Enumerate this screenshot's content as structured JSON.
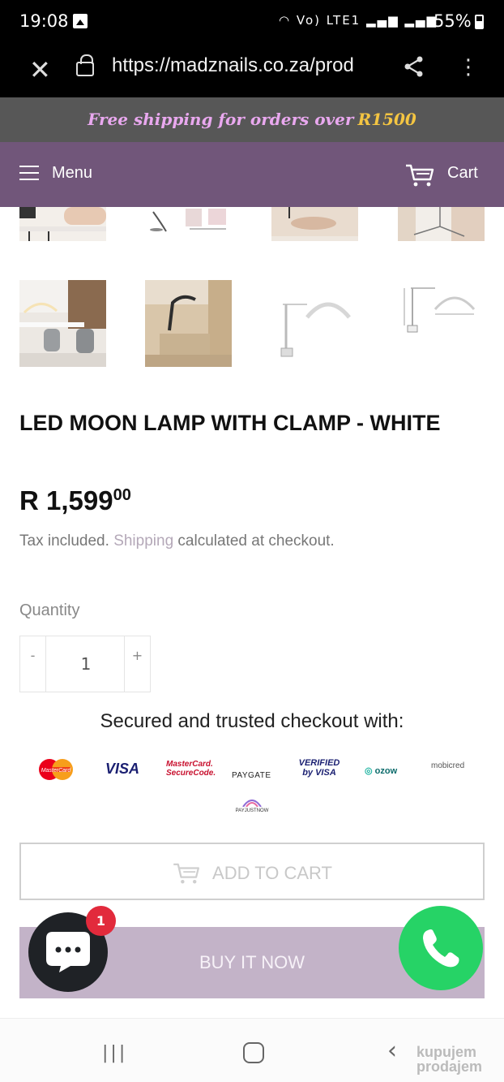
{
  "status_bar": {
    "time": "19:08",
    "network": "Vo) LTE1",
    "battery": "55%"
  },
  "browser": {
    "url": "https://madznails.co.za/prod"
  },
  "announcement": {
    "text": "Free shipping for orders over",
    "amount": "R1500",
    "text_color": "#e9a8ef",
    "amount_color": "#f4c542"
  },
  "header": {
    "menu_label": "Menu",
    "cart_label": "Cart",
    "bg_color": "#71567a"
  },
  "gallery": {
    "thumbnails": [
      "lamp-at-desk",
      "lamp-with-tools",
      "lamp-over-client",
      "lamp-base",
      "lamp-salon-room",
      "lamp-spa-bed",
      "lamp-white-clamp",
      "lamp-dimensions"
    ]
  },
  "product": {
    "title": "LED MOON LAMP WITH CLAMP - WHITE",
    "price_main": "R 1,599",
    "price_cents": "00",
    "tax_text_1": "Tax included.",
    "tax_link": "Shipping",
    "tax_text_2": "calculated at checkout."
  },
  "quantity": {
    "label": "Quantity",
    "minus": "-",
    "value": "1",
    "plus": "+"
  },
  "checkout": {
    "secure_text": "Secured and trusted checkout with:",
    "payment_methods": [
      "MasterCard",
      "VISA",
      "MasterCard. SecureCode.",
      "PAYGATE",
      "VERIFIED by VISA",
      "ozow",
      "mobicred",
      "PAYJUSTNOW"
    ]
  },
  "buttons": {
    "add_to_cart": "ADD TO CART",
    "buy_now": "BUY IT NOW"
  },
  "chat": {
    "badge_count": "1"
  },
  "watermark": {
    "line1": "kupujem",
    "line2": "prodajem"
  }
}
